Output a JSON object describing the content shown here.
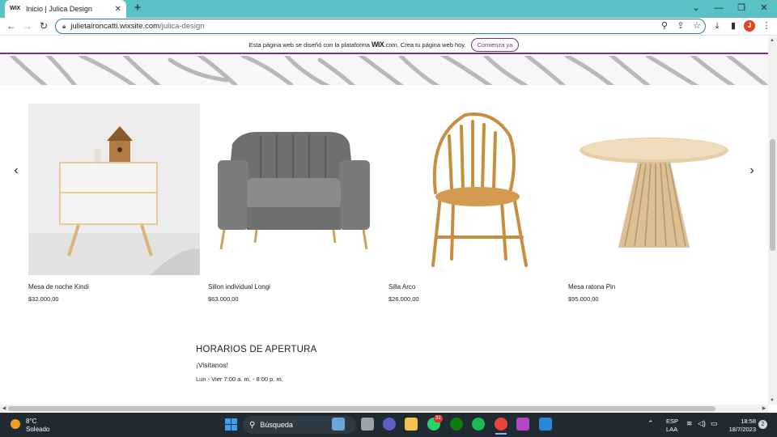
{
  "browser": {
    "tab_favicon": "WIX",
    "tab_title": "Inicio | Julica Design",
    "tab_close": "✕",
    "new_tab": "+",
    "url_host": "julietaironcatti.wixsite.com",
    "url_path": "/julica-design"
  },
  "banner": {
    "text_before": "Esta página web se diseñó con la plataforma",
    "brand": "WiX",
    "text_after": ".com. Crea tu página web hoy.",
    "cta": "Comienza ya",
    "accent_color": "#7d2a88"
  },
  "products": [
    {
      "name": "Mesa de noche Kindi",
      "price": "$32.000,00"
    },
    {
      "name": "Sillon individual Longi",
      "price": "$63.000,00"
    },
    {
      "name": "Silla Arco",
      "price": "$26.000,00"
    },
    {
      "name": "Mesa ratona Pin",
      "price": "$95.000,00"
    }
  ],
  "hours": {
    "title": "HORARIOS DE APERTURA",
    "subtitle": "¡Visítanos!",
    "schedule": "Lun - Vier 7:00 a. m. - 8:00 p. m."
  },
  "taskbar": {
    "temp": "8°C",
    "condition": "Soleado",
    "search_label": "Búsqueda",
    "lang_1": "ESP",
    "lang_2": "LAA",
    "time": "18:58",
    "date": "18/7/2023",
    "notifications": "2",
    "whatsapp_badge": "32"
  }
}
